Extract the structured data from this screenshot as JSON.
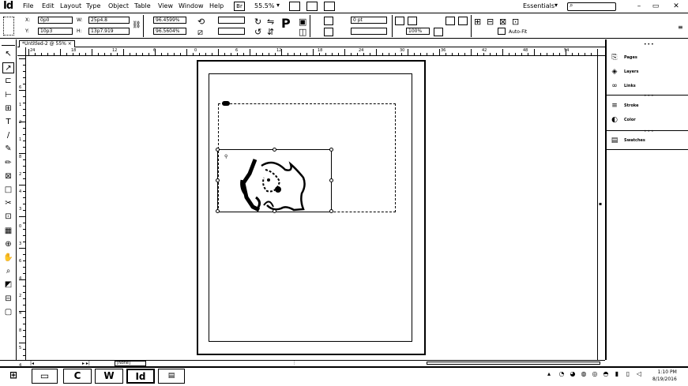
{
  "app": {
    "logo": "Id"
  },
  "menu": {
    "items": [
      "File",
      "Edit",
      "Layout",
      "Type",
      "Object",
      "Table",
      "View",
      "Window",
      "Help"
    ],
    "zoom": "55.5%",
    "workspace": "Essentials",
    "window_controls": [
      "–",
      "▭",
      "✕"
    ]
  },
  "control": {
    "x_label": "X:",
    "x_value": "0p0",
    "y_label": "Y:",
    "y_value": "10p3",
    "w_label": "W:",
    "w_value": "25p4.8",
    "h_label": "H:",
    "h_value": "13p7.919",
    "scale_x": "96.4599%",
    "scale_y": "96.5604%",
    "stroke_weight": "0 pt",
    "percent": "100%",
    "auto_fit": "Auto-Fit"
  },
  "tab": {
    "label": "*Untitled-2 @ 55%"
  },
  "ruler": {
    "h_numbers": [
      "24",
      "18",
      "12",
      "6",
      "0",
      "6",
      "12",
      "18",
      "24",
      "30",
      "36",
      "42",
      "48",
      "54"
    ],
    "v_numbers": [
      "6",
      "1",
      "2",
      "1",
      "8",
      "2",
      "4",
      "3",
      "0",
      "3",
      "6",
      "4",
      "2",
      "4",
      "8",
      "5",
      "4"
    ]
  },
  "tools": [
    "↖",
    "↗",
    "⊏",
    "⊢",
    "⊞",
    "T",
    "/",
    "✎",
    "✏",
    "⊠",
    "□",
    "✂",
    "⊡",
    "▦",
    "⊕",
    "✋",
    "⌕",
    "◩",
    "⊟",
    "▢"
  ],
  "status": {
    "page_selector": "[None]"
  },
  "panels": {
    "group1": [
      {
        "icon": "pages-icon",
        "glyph": "⎘",
        "label": "Pages"
      },
      {
        "icon": "layers-icon",
        "glyph": "◈",
        "label": "Layers"
      },
      {
        "icon": "links-icon",
        "glyph": "∞",
        "label": "Links"
      }
    ],
    "group2": [
      {
        "icon": "stroke-icon",
        "glyph": "≡",
        "label": "Stroke"
      },
      {
        "icon": "color-icon",
        "glyph": "◐",
        "label": "Color"
      }
    ],
    "group3": [
      {
        "icon": "swatches-icon",
        "glyph": "▤",
        "label": "Swatches"
      }
    ]
  },
  "taskbar": {
    "apps": [
      "C",
      "W",
      "Id"
    ],
    "clock_time": "1:10 PM",
    "clock_date": "8/19/2016"
  }
}
